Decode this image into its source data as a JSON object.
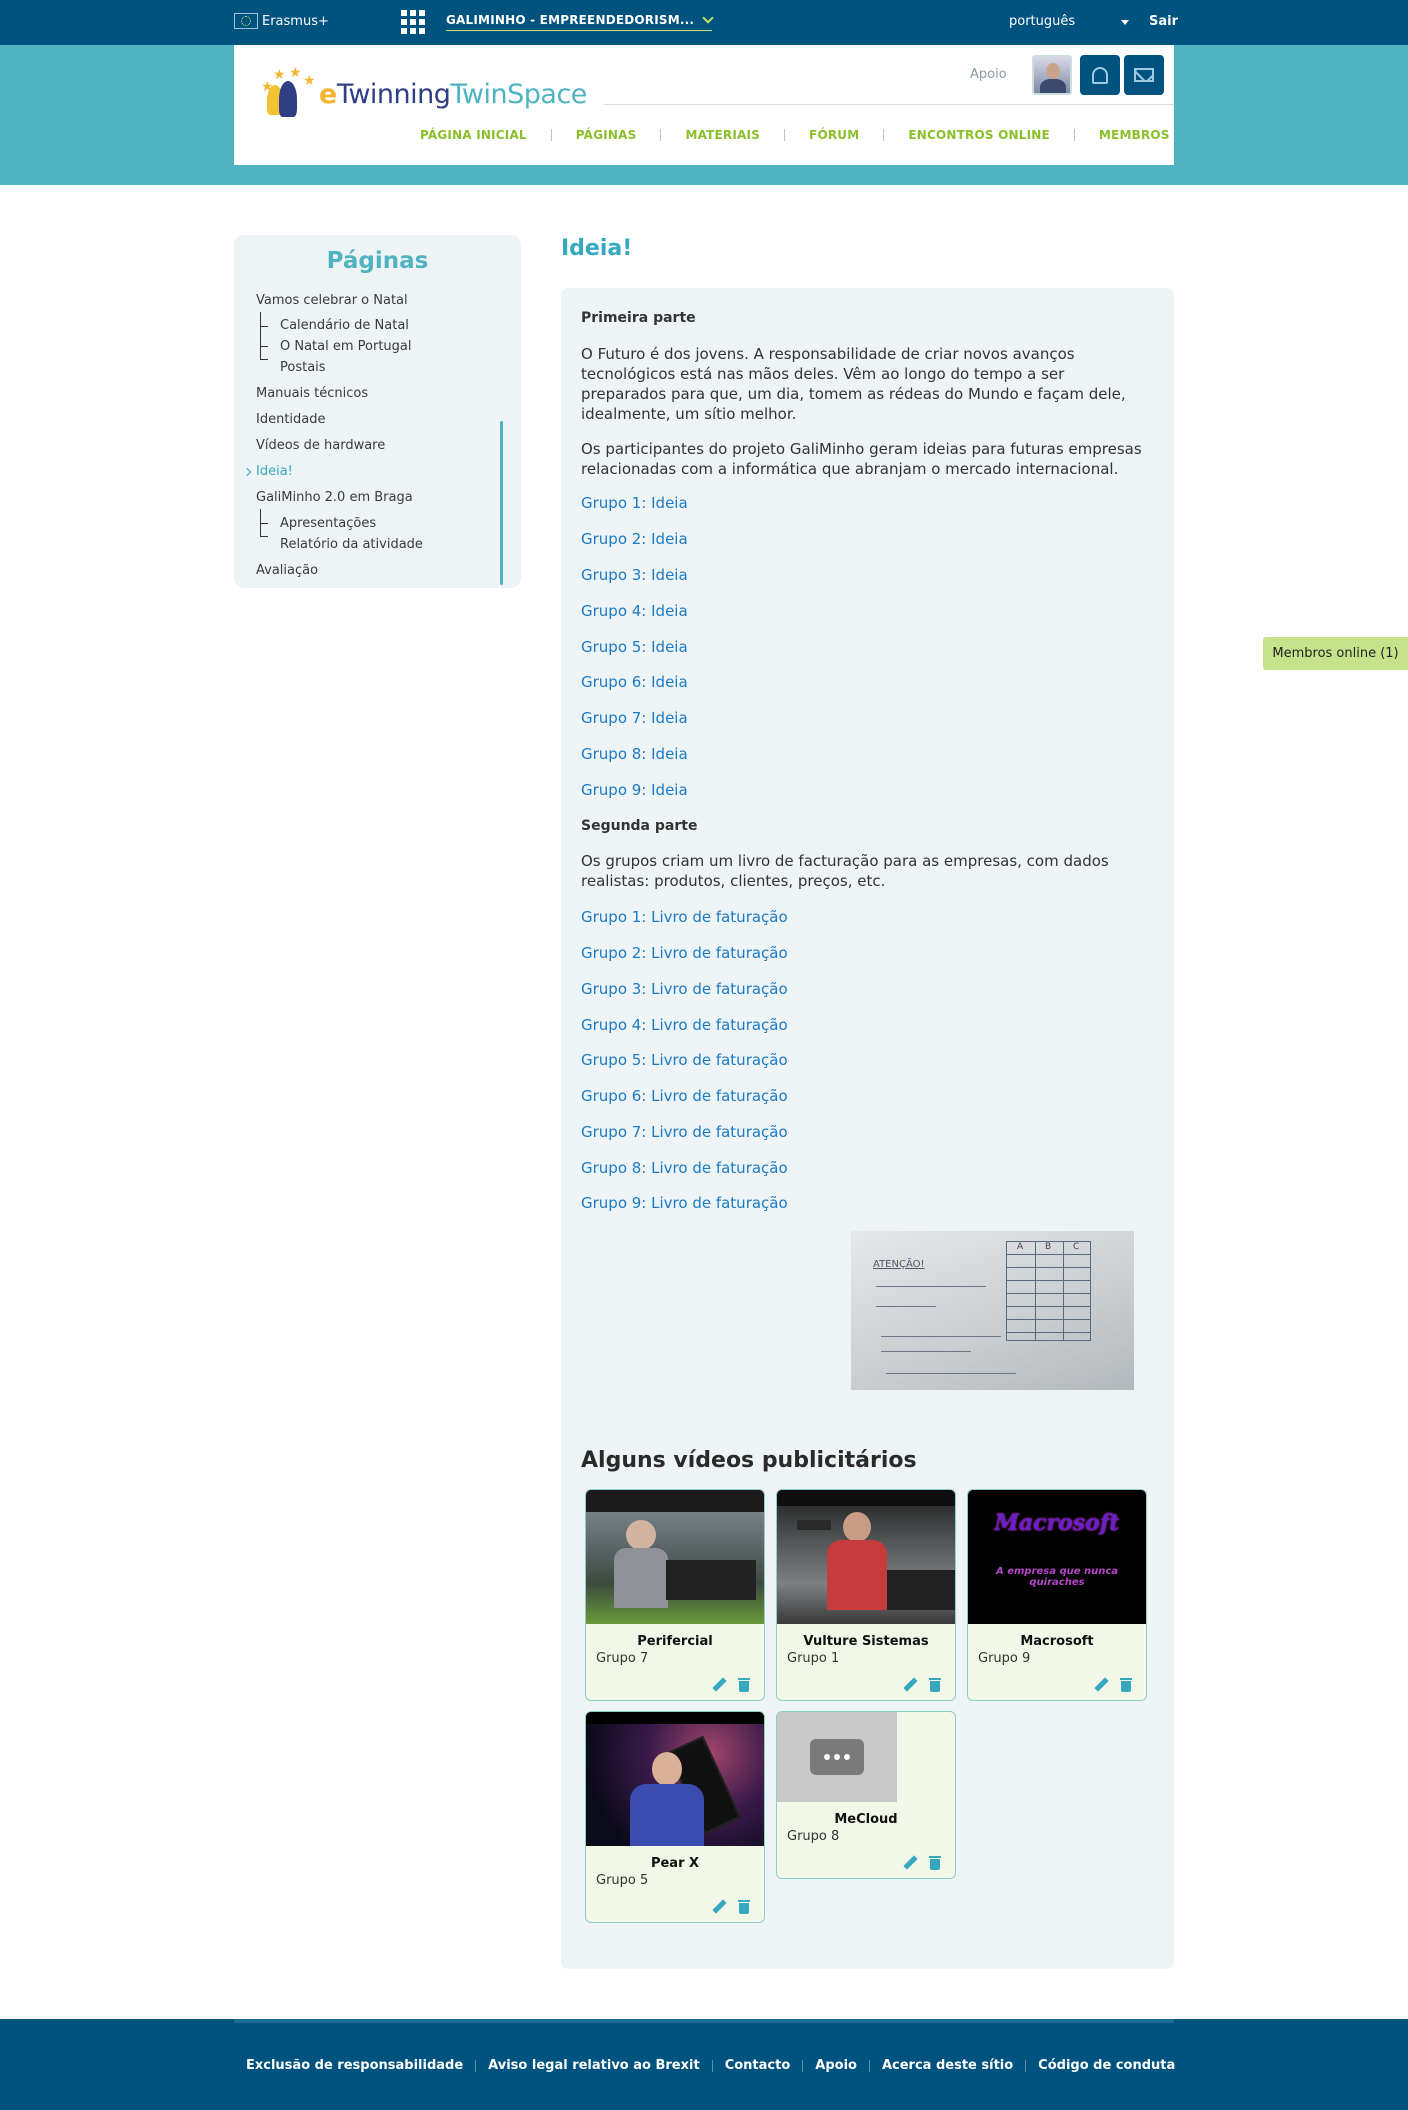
{
  "topbar": {
    "erasmus_label": "Erasmus+",
    "project_name": "GALIMINHO - EMPREENDEDORISM...",
    "language": "português",
    "logout": "Sair"
  },
  "header": {
    "logo_e": "e",
    "logo_twinning": "Twinning",
    "logo_twinspace": "TwinSpace",
    "support": "Apoio",
    "nav": [
      "PÁGINA INICIAL",
      "PÁGINAS",
      "MATERIAIS",
      "FÓRUM",
      "ENCONTROS ONLINE",
      "MEMBROS"
    ]
  },
  "sidebar": {
    "title": "Páginas",
    "items": [
      "Vamos celebrar o Natal",
      "Calendário de Natal",
      "O Natal em Portugal",
      "Postais",
      "Manuais técnicos",
      "Identidade",
      "Vídeos de hardware",
      "Ideia!",
      "GaliMinho 2.0 em Braga",
      "Apresentações",
      "Relatório da atividade",
      "Avaliação"
    ]
  },
  "content": {
    "page_title": "Ideia!",
    "part1_heading": "Primeira parte",
    "part1_p1": "O Futuro é dos jovens. A responsabilidade de criar novos avanços tecnológicos está nas mãos deles. Vêm ao longo do tempo a ser preparados para que, um dia, tomem as rédeas do Mundo e façam dele, idealmente, um sítio melhor.",
    "part1_p2": "Os participantes do projeto GaliMinho geram ideias para futuras empresas relacionadas com a informática que abranjam o mercado internacional.",
    "ideas": [
      "Grupo 1: Ideia",
      "Grupo 2: Ideia",
      "Grupo 3: Ideia",
      "Grupo 4: Ideia",
      "Grupo 5: Ideia",
      "Grupo 6: Ideia",
      "Grupo 7: Ideia",
      "Grupo 8: Ideia",
      "Grupo 9: Ideia"
    ],
    "part2_heading": "Segunda parte",
    "part2_p1": "Os grupos criam um livro de facturação para as empresas, com dados realistas: produtos, clientes, preços, etc.",
    "books": [
      "Grupo 1: Livro de faturação",
      "Grupo 2: Livro de faturação",
      "Grupo 3: Livro de faturação",
      "Grupo 4: Livro de faturação",
      "Grupo 5: Livro de faturação",
      "Grupo 6: Livro de faturação",
      "Grupo 7: Livro de faturação",
      "Grupo 8: Livro de faturação",
      "Grupo 9: Livro de faturação"
    ],
    "whiteboard_text": "ATENÇÃO!",
    "whiteboard_cols": [
      "A",
      "B",
      "C"
    ],
    "videos_title": "Alguns vídeos publicitários",
    "videos": [
      {
        "title": "Perifercial",
        "group": "Grupo 7"
      },
      {
        "title": "Vulture Sistemas",
        "group": "Grupo 1"
      },
      {
        "title": "Macrosoft",
        "group": "Grupo 9",
        "thumb_title": "Macrosoft",
        "thumb_slogan": "A empresa que nunca quiraches"
      },
      {
        "title": "Pear X",
        "group": "Grupo 5"
      },
      {
        "title": "MeCloud",
        "group": "Grupo 8"
      }
    ]
  },
  "online_members": "Membros online (1)",
  "footer": {
    "links": [
      "Exclusão de responsabilidade",
      "Aviso legal relativo ao Brexit",
      "Contacto",
      "Apoio",
      "Acerca deste sítio",
      "Código de conduta"
    ]
  },
  "colors": {
    "topbar": "#00527f",
    "teal": "#4fb3c2",
    "nav_green": "#8bbf2a",
    "link_blue": "#1a7bc4"
  }
}
